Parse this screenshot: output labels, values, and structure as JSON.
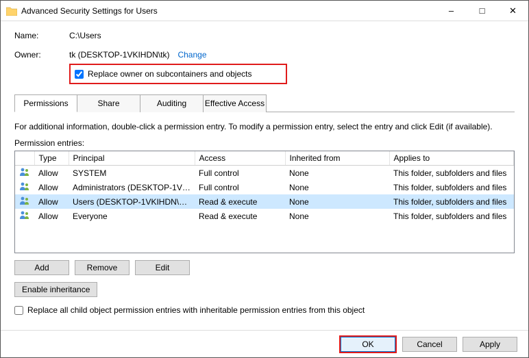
{
  "window": {
    "title": "Advanced Security Settings for Users"
  },
  "fields": {
    "name_label": "Name:",
    "name_value": "C:\\Users",
    "owner_label": "Owner:",
    "owner_value": "tk (DESKTOP-1VKIHDN\\tk)",
    "change_link": "Change",
    "replace_owner_label": "Replace owner on subcontainers and objects"
  },
  "tabs": {
    "permissions": "Permissions",
    "share": "Share",
    "auditing": "Auditing",
    "effective": "Effective Access"
  },
  "info_text": "For additional information, double-click a permission entry. To modify a permission entry, select the entry and click Edit (if available).",
  "entries_label": "Permission entries:",
  "table": {
    "headers": {
      "type": "Type",
      "principal": "Principal",
      "access": "Access",
      "inherited": "Inherited from",
      "applies": "Applies to"
    },
    "rows": [
      {
        "type": "Allow",
        "principal": "SYSTEM",
        "access": "Full control",
        "inherited": "None",
        "applies": "This folder, subfolders and files",
        "selected": false
      },
      {
        "type": "Allow",
        "principal": "Administrators (DESKTOP-1VK...",
        "access": "Full control",
        "inherited": "None",
        "applies": "This folder, subfolders and files",
        "selected": false
      },
      {
        "type": "Allow",
        "principal": "Users (DESKTOP-1VKIHDN\\Us...",
        "access": "Read & execute",
        "inherited": "None",
        "applies": "This folder, subfolders and files",
        "selected": true
      },
      {
        "type": "Allow",
        "principal": "Everyone",
        "access": "Read & execute",
        "inherited": "None",
        "applies": "This folder, subfolders and files",
        "selected": false
      }
    ]
  },
  "buttons": {
    "add": "Add",
    "remove": "Remove",
    "edit": "Edit",
    "enable_inheritance": "Enable inheritance",
    "replace_child": "Replace all child object permission entries with inheritable permission entries from this object",
    "ok": "OK",
    "cancel": "Cancel",
    "apply": "Apply"
  }
}
